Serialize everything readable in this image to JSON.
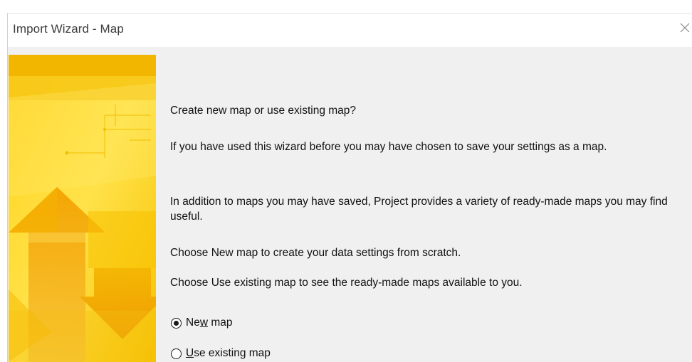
{
  "window": {
    "title": "Import Wizard - Map",
    "close_glyph": "×",
    "close_icon": "close-icon"
  },
  "content": {
    "question": "Create new map or use existing map?",
    "para1": "If you have used this wizard before you may have chosen to save your settings as a map.",
    "para2": "In addition to maps you may have saved, Project provides a variety of ready-made maps you may find useful.",
    "para3": "Choose New map to create your data settings from scratch.",
    "para4": "Choose Use existing map to see the ready-made maps available to you."
  },
  "options": {
    "new_map": {
      "pre": "Ne",
      "accel": "w",
      "post": " map",
      "selected": true
    },
    "use_existing": {
      "pre": "",
      "accel": "U",
      "post": "se existing map",
      "selected": false
    }
  },
  "colors": {
    "banner_base": "#f5c400",
    "banner_light": "#ffe34a",
    "banner_dark": "#e89a00",
    "dialog_bg": "#f0f0f0"
  }
}
